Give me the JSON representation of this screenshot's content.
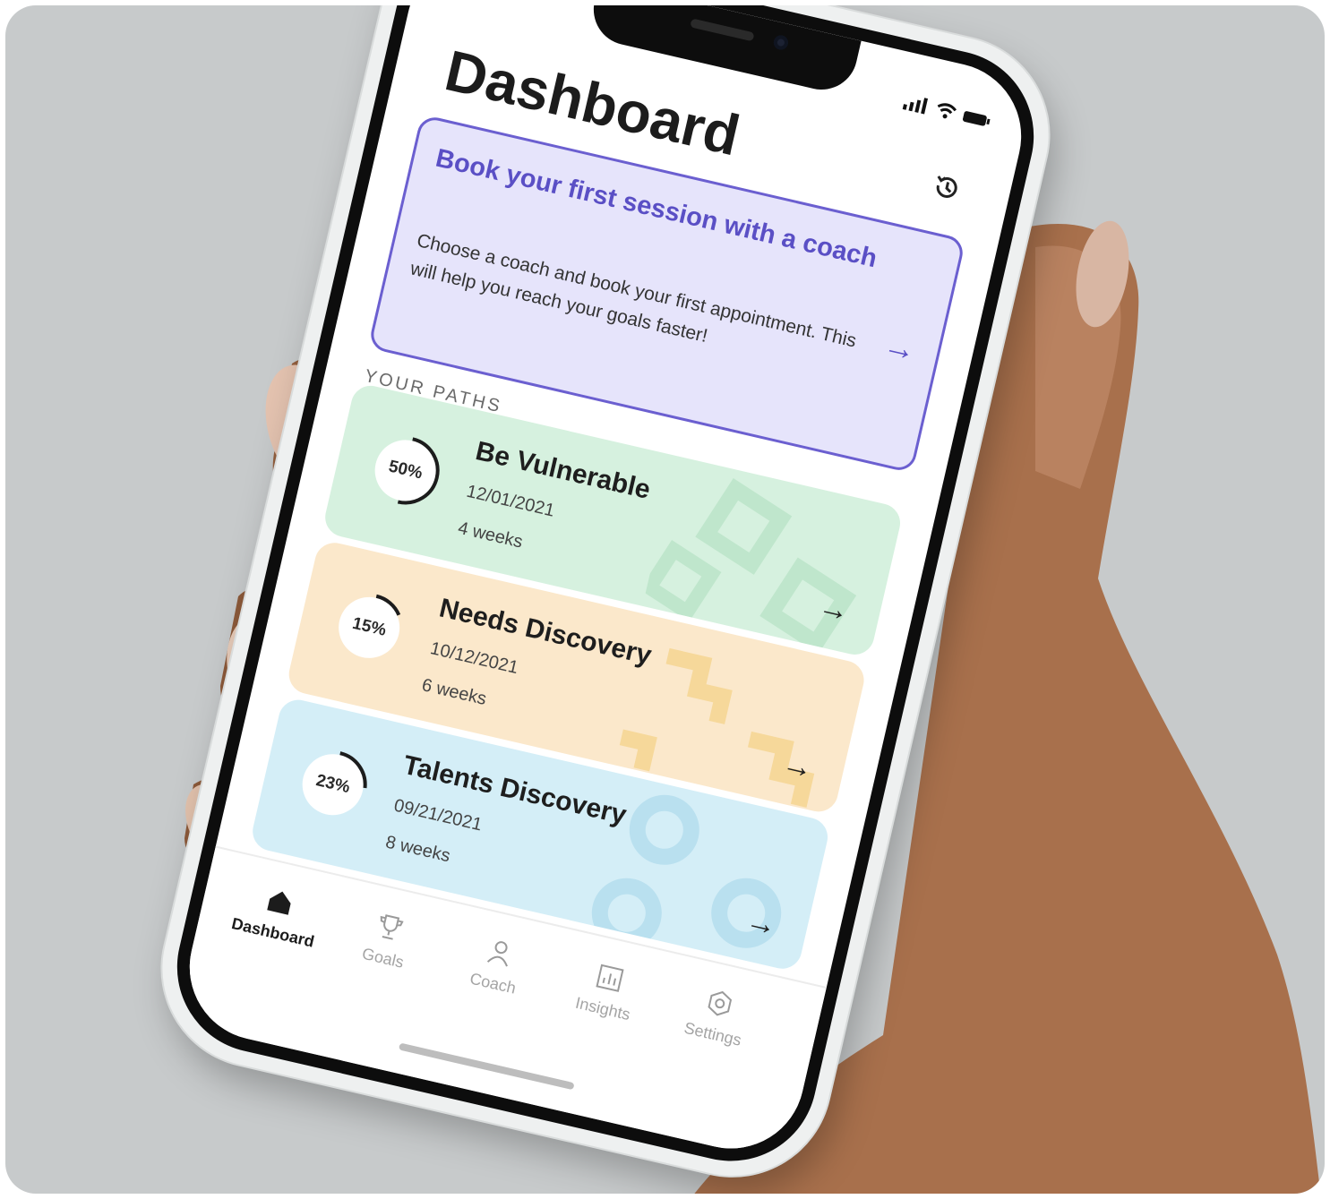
{
  "screen": {
    "title": "Dashboard",
    "history_icon": "history-icon"
  },
  "promo": {
    "title": "Book your first session with a coach",
    "body": "Choose a coach and book your first appointment. This will help you reach your goals faster!",
    "arrow_icon": "arrow-right-icon",
    "accent": "#5a4fc5",
    "background": "#e6e4fb"
  },
  "paths": {
    "section_label": "YOUR PATHS",
    "items": [
      {
        "percent_label": "50%",
        "progress": 0.5,
        "title": "Be Vulnerable",
        "date": "12/01/2021",
        "duration": "4 weeks",
        "color": "#d6f1df",
        "pattern_color": "#bfe6cc"
      },
      {
        "percent_label": "15%",
        "progress": 0.15,
        "title": "Needs Discovery",
        "date": "10/12/2021",
        "duration": "6 weeks",
        "color": "#fbe8cb",
        "pattern_color": "#f6d89a"
      },
      {
        "percent_label": "23%",
        "progress": 0.23,
        "title": "Talents Discovery",
        "date": "09/21/2021",
        "duration": "8 weeks",
        "color": "#d4eef7",
        "pattern_color": "#b9e0ef"
      }
    ]
  },
  "nav": {
    "items": [
      {
        "label": "Dashboard",
        "icon": "home-icon",
        "active": true
      },
      {
        "label": "Goals",
        "icon": "trophy-icon",
        "active": false
      },
      {
        "label": "Coach",
        "icon": "person-icon",
        "active": false
      },
      {
        "label": "Insights",
        "icon": "chart-icon",
        "active": false
      },
      {
        "label": "Settings",
        "icon": "gear-icon",
        "active": false
      }
    ]
  }
}
